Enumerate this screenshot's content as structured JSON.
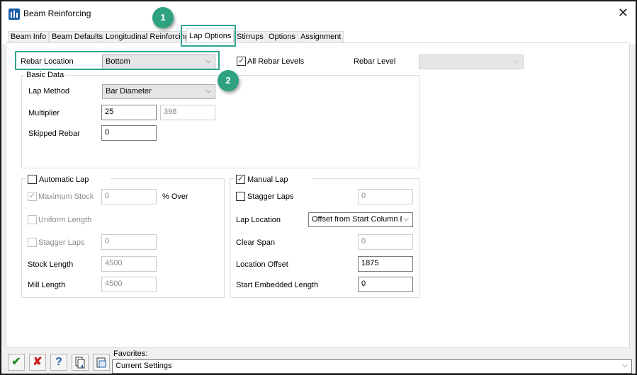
{
  "window": {
    "title": "Beam Reinforcing"
  },
  "tabs": [
    {
      "label": "Beam Info"
    },
    {
      "label": "Beam Defaults"
    },
    {
      "label": "Longitudinal Reinforcing"
    },
    {
      "label": "Lap Options"
    },
    {
      "label": "Stirrups"
    },
    {
      "label": "Options"
    },
    {
      "label": "Assignment"
    }
  ],
  "rebar_location": {
    "label": "Rebar Location",
    "value": "Bottom"
  },
  "all_rebar_levels": {
    "label": "All Rebar Levels",
    "checked": true
  },
  "rebar_level": {
    "label": "Rebar Level",
    "value": ""
  },
  "basic_data": {
    "title": "Basic Data",
    "lap_method_label": "Lap Method",
    "lap_method_value": "Bar Diameter",
    "multiplier_label": "Multiplier",
    "multiplier_value": "25",
    "multiplier_result": "398",
    "skipped_rebar_label": "Skipped Rebar",
    "skipped_rebar_value": "0"
  },
  "automatic_lap": {
    "label": "Automatic Lap",
    "max_stock_label": "Maximum Stock",
    "max_stock_value": "0",
    "pct_over_label": "% Over",
    "uniform_length_label": "Uniform Length",
    "stagger_laps_label": "Stagger Laps",
    "stagger_laps_value": "0",
    "stock_length_label": "Stock Length",
    "stock_length_value": "4500",
    "mill_length_label": "Mill Length",
    "mill_length_value": "4500"
  },
  "manual_lap": {
    "label": "Manual Lap",
    "stagger_laps_label": "Stagger Laps",
    "stagger_laps_value": "0",
    "lap_location_label": "Lap Location",
    "lap_location_value": "Offset from Start Column E",
    "clear_span_label": "Clear Span",
    "clear_span_value": "0",
    "location_offset_label": "Location Offset",
    "location_offset_value": "1875",
    "start_embedded_label": "Start Embedded Length",
    "start_embedded_value": "0"
  },
  "annotations": {
    "badge_1": "1",
    "badge_2": "2"
  },
  "footer": {
    "favorites_label": "Favorites:",
    "favorites_value": "Current Settings"
  },
  "colors": {
    "highlight": "#2ca58d",
    "badge": "#2ea27f",
    "ok": "#2e8b2e",
    "cancel": "#cc1f1f",
    "help": "#1f5fa8"
  }
}
